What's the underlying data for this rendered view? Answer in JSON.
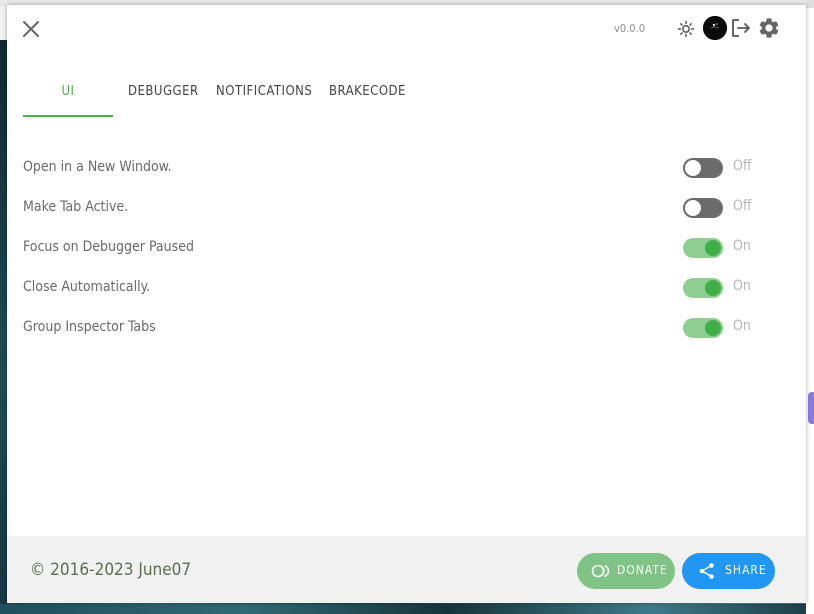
{
  "version": "v0.0.0",
  "tabs": [
    {
      "label": "UI",
      "active": true
    },
    {
      "label": "DEBUGGER",
      "active": false
    },
    {
      "label": "NOTIFICATIONS",
      "active": false
    },
    {
      "label": "BRAKECODE",
      "active": false
    }
  ],
  "settings": [
    {
      "label": "Open in a New Window.",
      "on": false,
      "state": "Off"
    },
    {
      "label": "Make Tab Active.",
      "on": false,
      "state": "Off"
    },
    {
      "label": "Focus on Debugger Paused",
      "on": true,
      "state": "On"
    },
    {
      "label": "Close Automatically.",
      "on": true,
      "state": "On"
    },
    {
      "label": "Group Inspector Tabs",
      "on": true,
      "state": "On"
    }
  ],
  "footer": {
    "copyright": "© 2016-2023 June07",
    "donate_label": "DONATE",
    "share_label": "SHARE"
  },
  "icons": {
    "close": "close-icon",
    "theme": "sun-icon",
    "avatar": "avatar",
    "logout": "logout-icon",
    "settings": "gear-icon",
    "donate": "donate-icon",
    "share": "share-icon"
  },
  "colors": {
    "accent": "#4caf50",
    "toggle_on_track": "#8fce93",
    "toggle_on_knob": "#3fae46",
    "toggle_off_track": "#6b6b6b",
    "donate_button": "#7fc485",
    "share_button": "#2196f3"
  }
}
